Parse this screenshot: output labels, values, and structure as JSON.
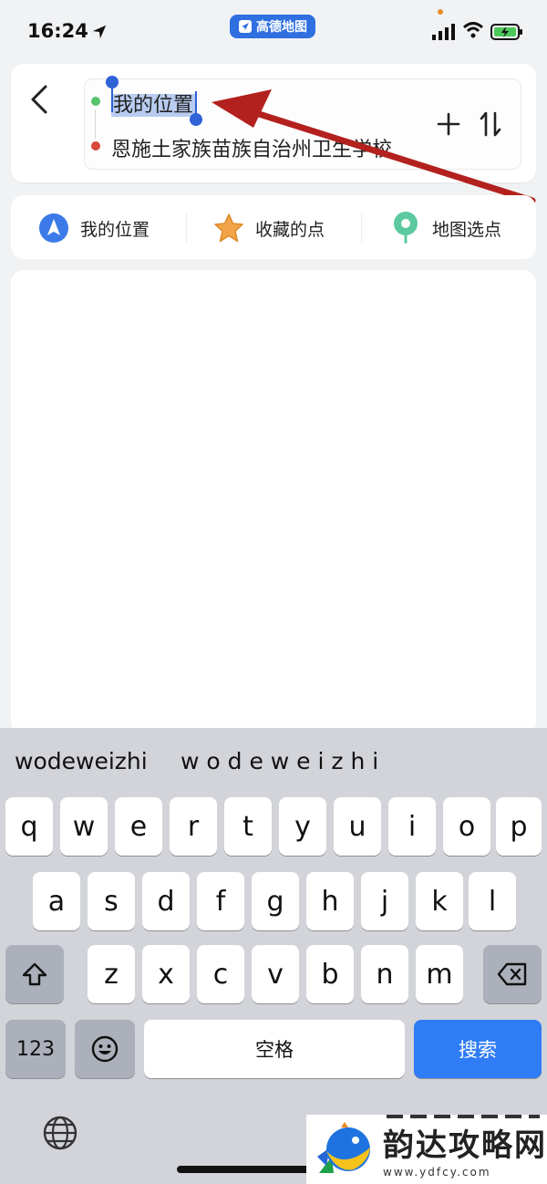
{
  "status_bar": {
    "time": "16:24",
    "app_pill": "高德地图"
  },
  "route": {
    "origin": "我的位置",
    "destination": "恩施土家族苗族自治州卫生学校"
  },
  "quick_actions": [
    {
      "label": "我的位置",
      "icon": "navigation-arrow-icon"
    },
    {
      "label": "收藏的点",
      "icon": "star-icon"
    },
    {
      "label": "地图选点",
      "icon": "map-pin-icon"
    }
  ],
  "keyboard": {
    "candidates": [
      "wodeweizhi",
      "w o d e w e i z h i"
    ],
    "row1": [
      "q",
      "w",
      "e",
      "r",
      "t",
      "y",
      "u",
      "i",
      "o",
      "p"
    ],
    "row2": [
      "a",
      "s",
      "d",
      "f",
      "g",
      "h",
      "j",
      "k",
      "l"
    ],
    "row3": [
      "z",
      "x",
      "c",
      "v",
      "b",
      "n",
      "m"
    ],
    "numbers_key": "123",
    "space_key": "空格",
    "search_key": "搜索"
  },
  "watermark": {
    "name": "韵达攻略网",
    "url": "www.ydfcy.com"
  },
  "colors": {
    "accent_blue": "#2f7cf6",
    "origin_green": "#55c36e",
    "dest_red": "#d9473d",
    "annotation_arrow": "#b3211e"
  }
}
